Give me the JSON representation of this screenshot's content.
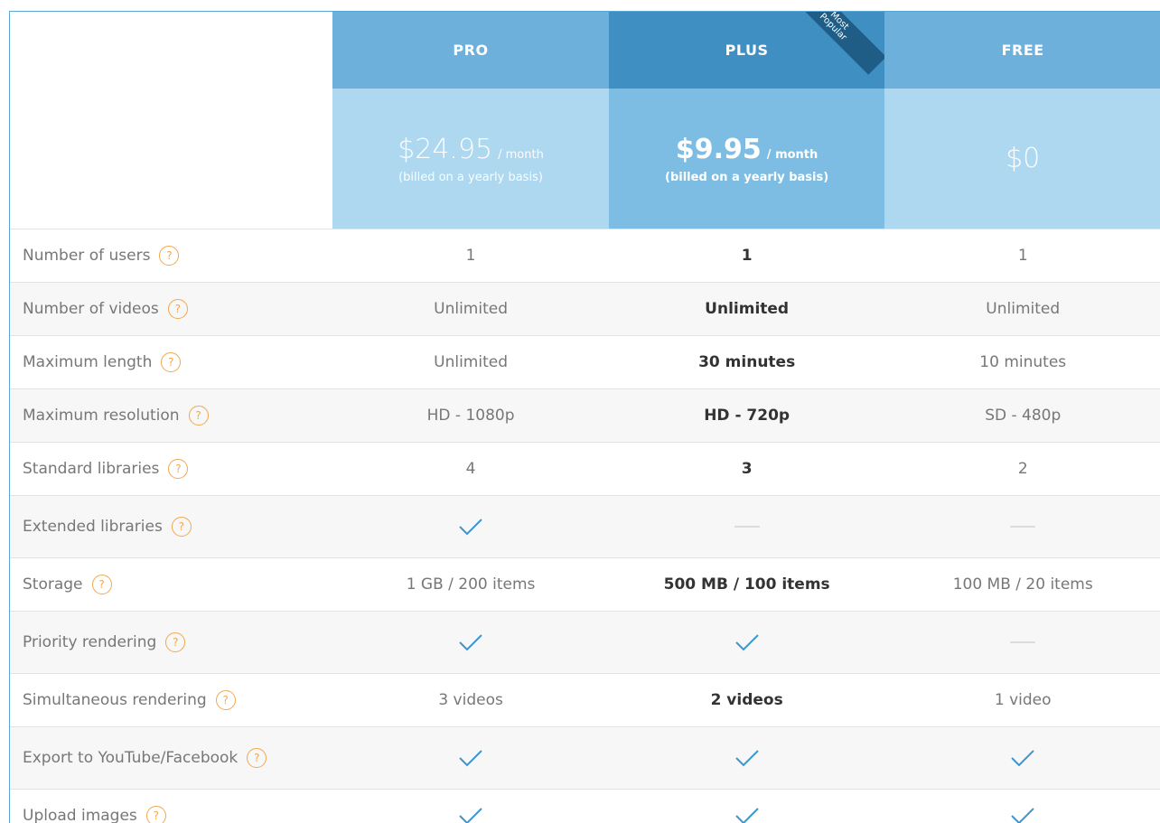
{
  "plans": [
    {
      "name": "PRO",
      "price": "$24.95",
      "per": "/ month",
      "billing": "(billed on a yearly basis)"
    },
    {
      "name": "PLUS",
      "price": "$9.95",
      "per": "/ month",
      "billing": "(billed on a yearly basis)",
      "ribbon": "Most Popular"
    },
    {
      "name": "FREE",
      "price": "$0",
      "per": "",
      "billing": ""
    }
  ],
  "colors": {
    "header_blue": "#6eb0dc",
    "header_blue_dark": "#3f8fc3",
    "price_bg": "#aed8f0",
    "price_bg_plus": "#7dbde3",
    "ribbon": "#1f5d86",
    "help_icon": "#f2a74c",
    "check": "#3b96d2"
  },
  "features": [
    {
      "label": "Number of users",
      "pro": "1",
      "plus": "1",
      "free": "1"
    },
    {
      "label": "Number of videos",
      "pro": "Unlimited",
      "plus": "Unlimited",
      "free": "Unlimited"
    },
    {
      "label": "Maximum length",
      "pro": "Unlimited",
      "plus": "30 minutes",
      "free": "10 minutes"
    },
    {
      "label": "Maximum resolution",
      "pro": "HD - 1080p",
      "plus": "HD - 720p",
      "free": "SD - 480p"
    },
    {
      "label": "Standard libraries",
      "pro": "4",
      "plus": "3",
      "free": "2"
    },
    {
      "label": "Extended libraries",
      "pro": "check",
      "plus": "dash",
      "free": "dash"
    },
    {
      "label": "Storage",
      "pro": "1 GB / 200 items",
      "plus": "500 MB / 100 items",
      "free": "100 MB / 20 items"
    },
    {
      "label": "Priority rendering",
      "pro": "check",
      "plus": "check",
      "free": "dash"
    },
    {
      "label": "Simultaneous rendering",
      "pro": "3 videos",
      "plus": "2 videos",
      "free": "1 video"
    },
    {
      "label": "Export to YouTube/Facebook",
      "pro": "check",
      "plus": "check",
      "free": "check"
    },
    {
      "label": "Upload images",
      "pro": "check",
      "plus": "check",
      "free": "check"
    }
  ],
  "help_icon_glyph": "?"
}
